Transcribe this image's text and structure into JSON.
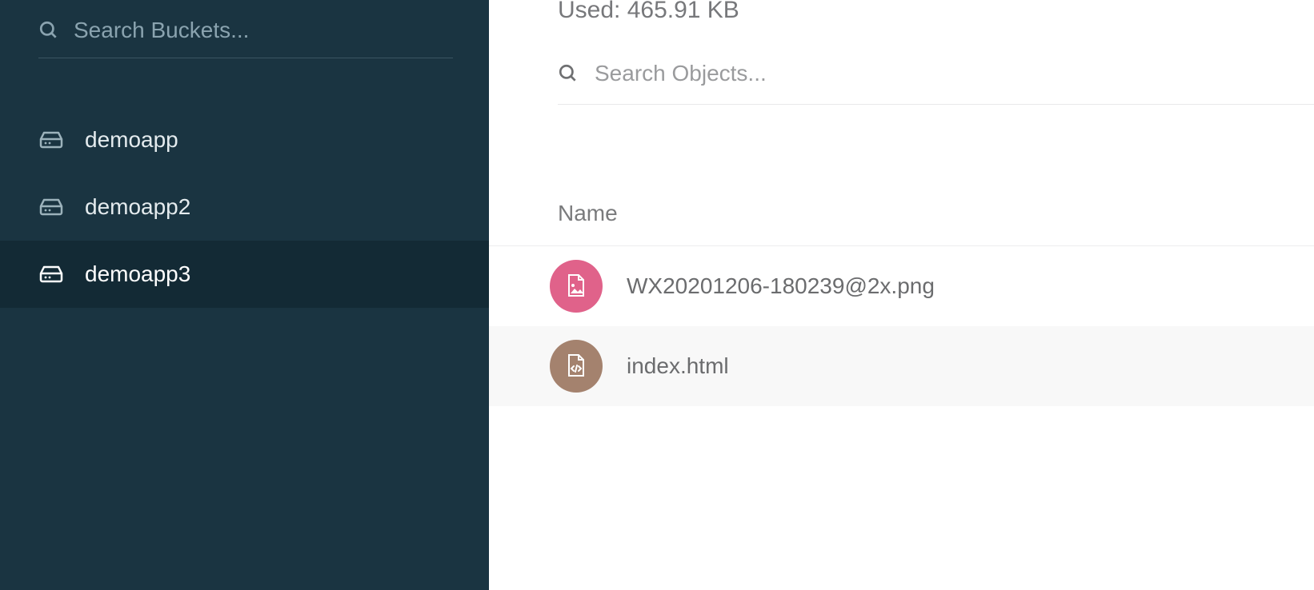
{
  "sidebar": {
    "search_placeholder": "Search Buckets...",
    "buckets": [
      {
        "label": "demoapp",
        "active": false
      },
      {
        "label": "demoapp2",
        "active": false
      },
      {
        "label": "demoapp3",
        "active": true
      }
    ]
  },
  "main": {
    "used_label": "Used: 465.91 KB",
    "object_search_placeholder": "Search Objects...",
    "col_name_label": "Name",
    "files": [
      {
        "name": "WX20201206-180239@2x.png",
        "icon": "image",
        "color": "pink",
        "alt": false
      },
      {
        "name": "index.html",
        "icon": "code",
        "color": "brown",
        "alt": true
      }
    ]
  }
}
